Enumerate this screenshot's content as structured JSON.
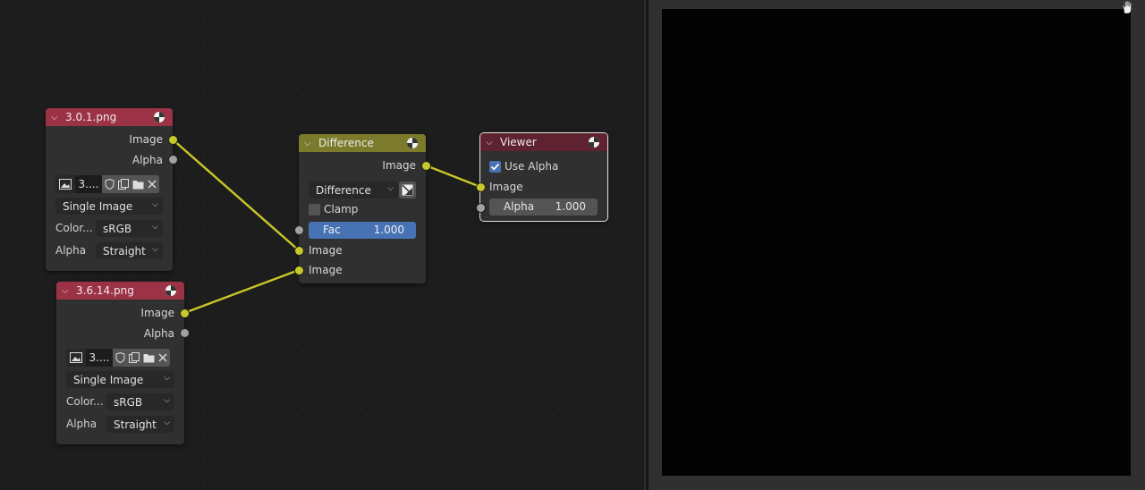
{
  "nodes": {
    "image1": {
      "title": "3.0.1.png",
      "out_image": "Image",
      "out_alpha": "Alpha",
      "image_name": "3....",
      "source": "Single Image",
      "color_label": "Color...",
      "color_value": "sRGB",
      "alpha_label": "Alpha",
      "alpha_value": "Straight"
    },
    "image2": {
      "title": "3.6.14.png",
      "out_image": "Image",
      "out_alpha": "Alpha",
      "image_name": "3....",
      "source": "Single Image",
      "color_label": "Color...",
      "color_value": "sRGB",
      "alpha_label": "Alpha",
      "alpha_value": "Straight"
    },
    "difference": {
      "title": "Difference",
      "out_image": "Image",
      "blend_mode": "Difference",
      "clamp_label": "Clamp",
      "fac_label": "Fac",
      "fac_value": "1.000",
      "in_image1": "Image",
      "in_image2": "Image"
    },
    "viewer": {
      "title": "Viewer",
      "use_alpha_label": "Use Alpha",
      "in_image": "Image",
      "alpha_label": "Alpha",
      "alpha_value": "1.000"
    }
  },
  "colors": {
    "image_header": "#9c3245",
    "mix_header": "#7b7b2b",
    "output_header": "#5e2230",
    "socket_color": "#c8c829",
    "socket_float": "#a1a1a1",
    "link": "#c8c829",
    "field_active": "#4772b3"
  },
  "icons": [
    "chevron-down-icon",
    "globe-preview-icon",
    "image-browse-icon",
    "fake-user-shield-icon",
    "duplicate-icon",
    "folder-icon",
    "close-icon",
    "clamp-checkbox",
    "use-alpha-check-icon",
    "hand-pan-icon"
  ]
}
